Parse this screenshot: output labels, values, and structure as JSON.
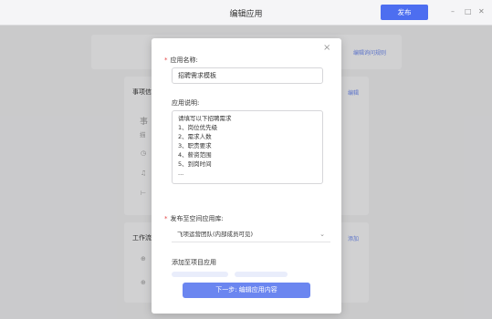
{
  "window": {
    "title": "编辑应用",
    "publish_label": "发布",
    "min_glyph": "–",
    "max_glyph": "□",
    "close_glyph": "✕"
  },
  "background": {
    "link_top_right": "编辑询问规则",
    "section1_title": "事项信",
    "section1_action": "编辑",
    "section1_sub1": "事",
    "section1_sub2": "描",
    "section2_title": "工作流",
    "section2_action": "添加"
  },
  "modal": {
    "close_glyph": "×",
    "required_mark": "*",
    "name_label": "应用名称:",
    "name_value": "招聘需求模板",
    "desc_label": "应用说明:",
    "desc_lines": [
      "请填写以下招聘需求",
      "1、岗位优先级",
      "2、需求人数",
      "3、职责要求",
      "4、薪资范围",
      "5、到岗时间",
      "..."
    ],
    "publish_label": "发布至空间应用库:",
    "publish_value": "飞项运营团队(内部成员可见)",
    "chevron_glyph": "⌄",
    "add_label": "添加至项目应用",
    "next_label": "下一步: 编辑应用内容"
  }
}
